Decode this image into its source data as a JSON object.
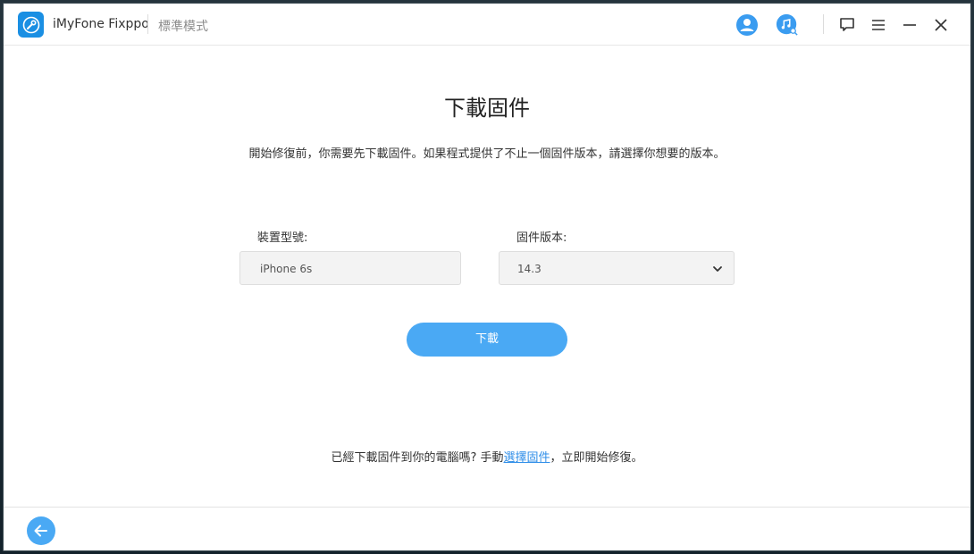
{
  "titlebar": {
    "app_name": "iMyFone Fixppo",
    "mode": "標準模式",
    "icons": [
      "wrench-logo-icon",
      "user-icon",
      "music-search-icon",
      "feedback-icon",
      "menu-icon",
      "minimize-icon",
      "close-icon"
    ]
  },
  "main": {
    "title": "下載固件",
    "description": "開始修復前，你需要先下載固件。如果程式提供了不止一個固件版本，請選擇你想要的版本。",
    "model_label": "裝置型號:",
    "model_value": "iPhone 6s",
    "version_label": "固件版本:",
    "version_value": "14.3",
    "download_label": "下載",
    "note_prefix": "已經下載固件到你的電腦嗎? 手動",
    "note_link": "選擇固件",
    "note_suffix": "，立即開始修復。"
  },
  "footer": {
    "back_icon": "arrow-left-icon"
  },
  "colors": {
    "accent": "#4aa9f4",
    "link": "#2f8ee8",
    "logo": "#1a8fe3"
  }
}
